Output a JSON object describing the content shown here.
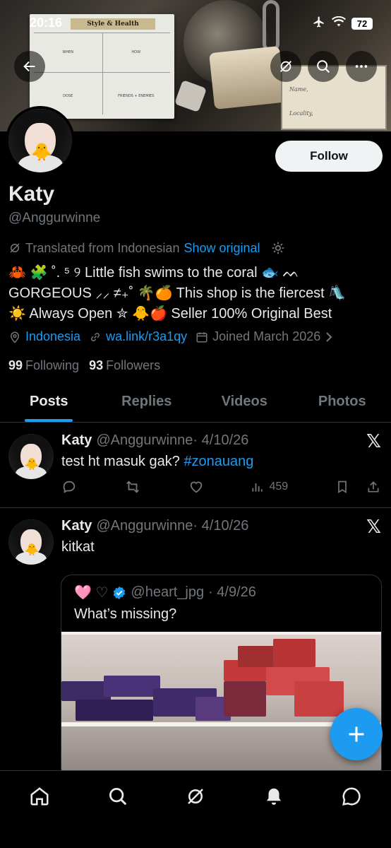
{
  "status_bar": {
    "time": "20:16",
    "battery": "72"
  },
  "profile": {
    "name": "Katy",
    "handle": "@Anggurwinne",
    "follow_label": "Follow",
    "translated_text": "Translated from Indonesian",
    "show_original": "Show original",
    "bio_lines": [
      "🦀 🧩 ˚. ⁵ ୨ Little fish swims to the coral 🐟 ᨓ",
      "GORGEOUS ⸝⸝ ≠₊˚ 🌴🍊 This shop is the fiercest 🛝",
      "☀️ Always Open ✮ 🐥🍎 Seller 100% Original Best"
    ],
    "location": "Indonesia",
    "link": "wa.link/r3a1qy",
    "joined": "Joined March 2026",
    "following_count": "99",
    "following_label": "Following",
    "followers_count": "93",
    "followers_label": "Followers"
  },
  "tabs": [
    {
      "label": "Posts",
      "active": true
    },
    {
      "label": "Replies",
      "active": false
    },
    {
      "label": "Videos",
      "active": false
    },
    {
      "label": "Photos",
      "active": false
    }
  ],
  "posts": [
    {
      "name": "Katy",
      "handle": "@Anggurwinne",
      "date": "· 4/10/26",
      "text_plain": "test ht masuk gak?",
      "hashtag": "#zonauang",
      "views": "459"
    },
    {
      "name": "Katy",
      "handle": "@Anggurwinne",
      "date": "· 4/10/26",
      "text_plain": "kitkat",
      "quote": {
        "author_emoji": "🩷 ♡",
        "handle": "@heart_jpg",
        "date": "· 4/9/26",
        "text": "What’s missing?"
      }
    }
  ],
  "banner_card": {
    "title": "Style & Health",
    "cells": [
      "WHEN",
      "HOW",
      "DOSE",
      "FRIENDS + ENEMIES"
    ],
    "receipt_lines": [
      "Name,",
      "Locality,"
    ]
  },
  "icons": {
    "back": "back-arrow-icon",
    "grok": "grok-icon",
    "search": "search-icon",
    "more": "more-icon",
    "x_logo": "𝕏"
  },
  "colors": {
    "accent": "#1d9bf0",
    "background": "#000000",
    "muted": "#71767b"
  }
}
